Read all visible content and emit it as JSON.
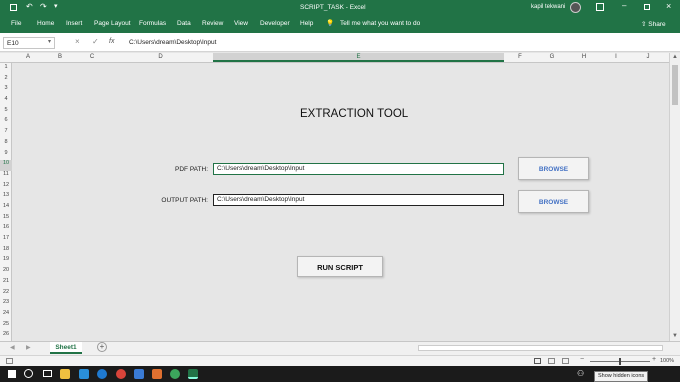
{
  "window": {
    "title": "SCRIPT_TASK  -  Excel",
    "user": "kapil tekwani",
    "share_label": "Share"
  },
  "ribbon": {
    "tabs": [
      "File",
      "Home",
      "Insert",
      "Page Layout",
      "Formulas",
      "Data",
      "Review",
      "View",
      "Developer",
      "Help"
    ],
    "tell_me": "Tell me what you want to do"
  },
  "formula": {
    "name_box": "E10",
    "fx": "fx",
    "value": "C:\\Users\\dream\\Desktop\\Input"
  },
  "grid": {
    "columns": [
      "A",
      "B",
      "C",
      "D",
      "E",
      "F",
      "G",
      "H",
      "I",
      "J"
    ],
    "rows": [
      "1",
      "2",
      "3",
      "4",
      "5",
      "6",
      "7",
      "8",
      "9",
      "10",
      "11",
      "12",
      "13",
      "14",
      "15",
      "16",
      "17",
      "18",
      "19",
      "20",
      "21",
      "22",
      "23",
      "24",
      "25",
      "26"
    ]
  },
  "form": {
    "title": "EXTRACTION TOOL",
    "pdf_label": "PDF PATH:",
    "pdf_value": "C:\\Users\\dream\\Desktop\\Input",
    "output_label": "OUTPUT PATH:",
    "output_value": "C:\\Users\\dream\\Desktop\\Input",
    "browse_label": "BROWSE",
    "run_label": "RUN SCRIPT"
  },
  "sheets": {
    "active": "Sheet1"
  },
  "status": {
    "zoom": "100%"
  },
  "taskbar": {
    "tooltip": "Show hidden icons"
  },
  "colors": {
    "excel_green": "#217346",
    "browse_blue": "#4472c4"
  }
}
